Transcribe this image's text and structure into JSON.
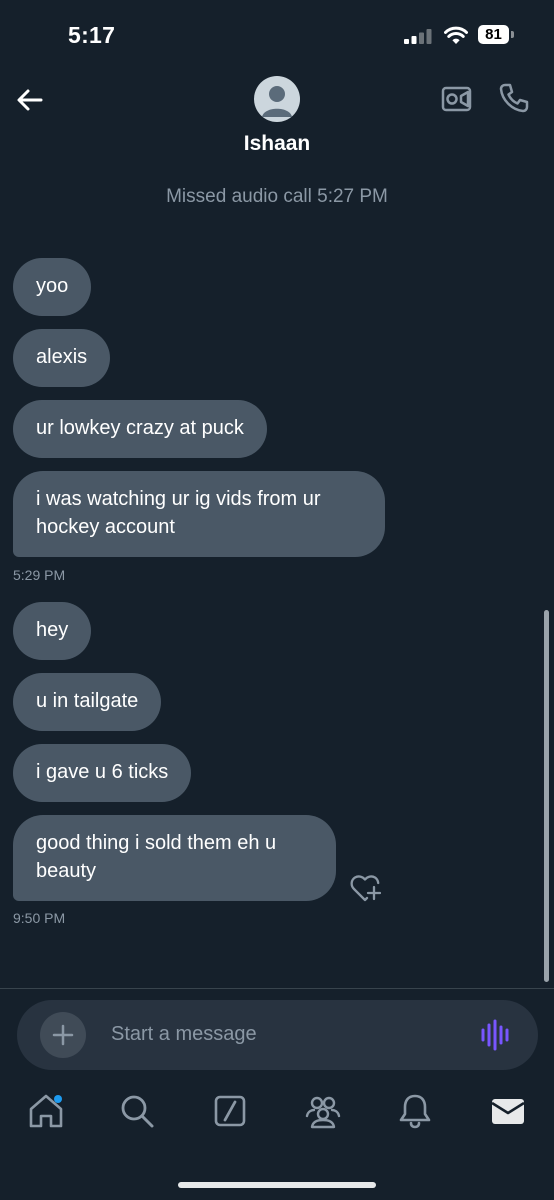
{
  "status_bar": {
    "time": "5:17",
    "battery": "81"
  },
  "header": {
    "contact_name": "Ishaan"
  },
  "missed_call": "Missed audio call 5:27 PM",
  "group1": {
    "messages": [
      "yoo",
      "alexis",
      "ur lowkey crazy at puck",
      "i was watching ur ig vids from ur hockey account"
    ],
    "timestamp": "5:29 PM"
  },
  "group2": {
    "messages": [
      "hey",
      "u in tailgate",
      "i gave u 6 ticks",
      "good thing i sold them eh u beauty"
    ],
    "timestamp": "9:50 PM"
  },
  "composer": {
    "placeholder": "Start a message"
  },
  "tabs": [
    "home-icon",
    "search-icon",
    "grok-icon",
    "communities-icon",
    "notifications-icon",
    "messages-icon"
  ],
  "colors": {
    "background": "#15202b",
    "bubble": "#4a5866",
    "accent": "#1d9bf0",
    "voice": "#7856ff"
  }
}
